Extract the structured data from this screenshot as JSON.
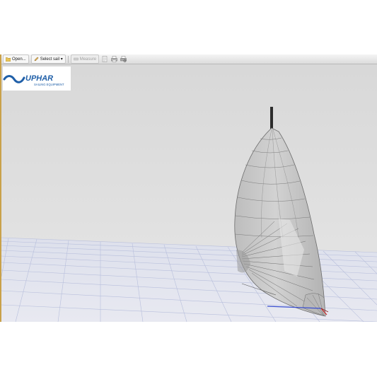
{
  "toolbar": {
    "open_label": "Open...",
    "select_sail_label": "Select sail ▾",
    "measure_label": "Measure"
  },
  "logo": {
    "brand_text": "UPHAR",
    "tagline": "SAILING EQUIPMENT",
    "color": "#1f5fa8"
  },
  "viewport": {
    "background_color": "#dcdcdc",
    "grid_color": "#b7bfdc",
    "sail_color": "#c8c8c8"
  }
}
